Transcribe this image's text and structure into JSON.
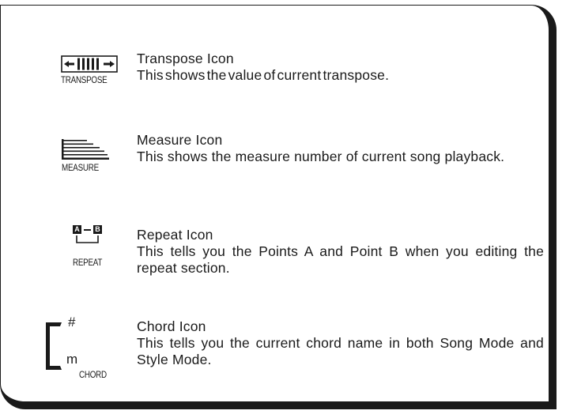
{
  "entries": [
    {
      "icon_name": "transpose-icon",
      "icon_label": "TRANSPOSE",
      "title": "Transpose Icon",
      "description": "This shows the value of current transpose."
    },
    {
      "icon_name": "measure-icon",
      "icon_label": "MEASURE",
      "title": "Measure Icon",
      "description": "This shows the measure number of current song playback."
    },
    {
      "icon_name": "repeat-icon",
      "icon_label": "REPEAT",
      "icon_letters": [
        "A",
        "B"
      ],
      "title": "Repeat Icon",
      "description": "This tells you the Points A and Point B when you editing the repeat section."
    },
    {
      "icon_name": "chord-icon",
      "icon_label": "CHORD",
      "icon_symbols": [
        "#",
        "m"
      ],
      "title": "Chord Icon",
      "description": "This tells you the current chord name in both Song Mode and Style Mode."
    }
  ]
}
